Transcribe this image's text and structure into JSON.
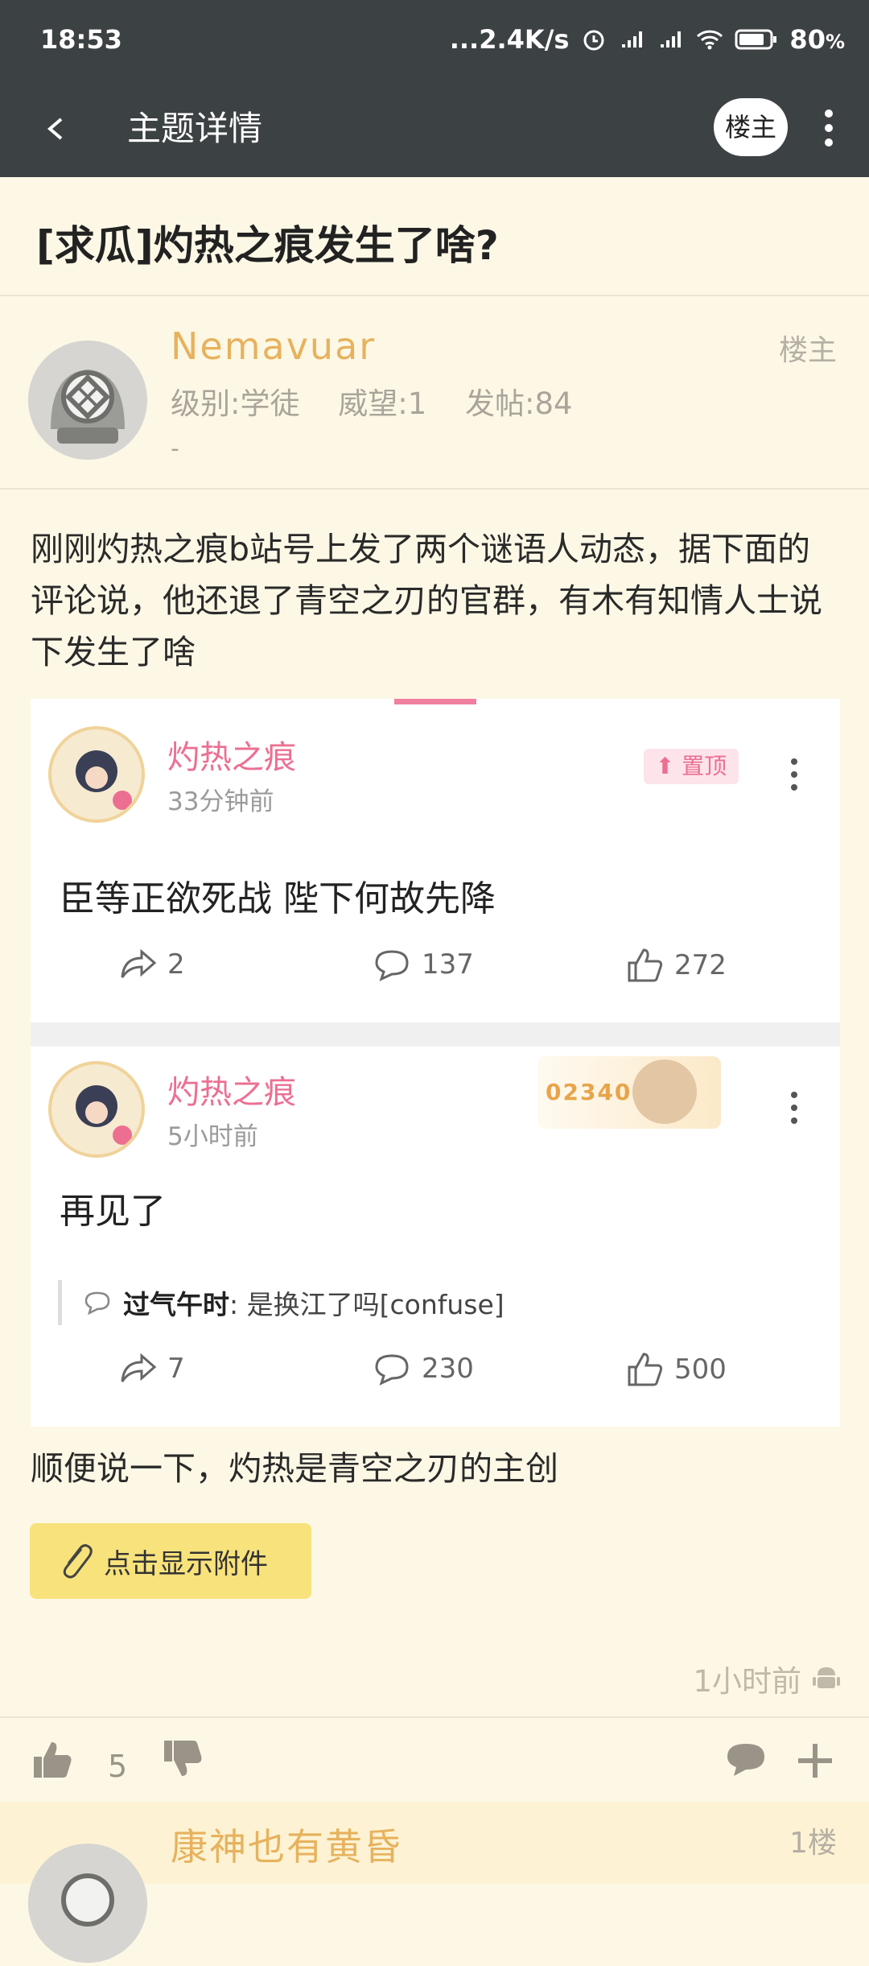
{
  "status_bar": {
    "time": "18:53",
    "network_speed": "...2.4K/s",
    "battery": "80",
    "battery_unit": "%",
    "icons": [
      "alarm-icon",
      "signal-icon",
      "hd-signal-icon",
      "wifi-icon",
      "battery-icon"
    ]
  },
  "app_bar": {
    "title": "主题详情",
    "op_button": "楼主"
  },
  "topic": {
    "title": "[求瓜]灼热之痕发生了啥?"
  },
  "author": {
    "name": "Nemavuar",
    "level": "级别:学徒",
    "reputation": "威望:1",
    "posts": "发帖:84",
    "signature": "-",
    "tag": "楼主"
  },
  "post": {
    "body": "刚刚灼热之痕b站号上发了两个谜语人动态，据下面的评论说，他还退了青空之刃的官群，有木有知情人士说下发生了啥",
    "note": "顺便说一下，灼热是青空之刃的主创",
    "attachment_label": "点击显示附件",
    "time": "1小时前",
    "likes": "5"
  },
  "embedded": {
    "card1": {
      "name": "灼热之痕",
      "time": "33分钟前",
      "pin_label": "置顶",
      "text": "臣等正欲死战 陛下何故先降",
      "shares": "2",
      "comments": "137",
      "likes": "272"
    },
    "card2": {
      "name": "灼热之痕",
      "time": "5小时前",
      "badge_number": "023408",
      "text": "再见了",
      "quote_user": "过气午时",
      "quote_sep": ":",
      "quote_text": "是换江了吗[confuse]",
      "shares": "7",
      "comments": "230",
      "likes": "500"
    }
  },
  "next_reply": {
    "name": "康神也有黄昏",
    "floor": "1楼"
  },
  "colors": {
    "bar": "#3c4144",
    "background": "#fdf8e6",
    "username": "#e7b25e",
    "pink": "#ec6f92",
    "attachment": "#f8e27c"
  }
}
